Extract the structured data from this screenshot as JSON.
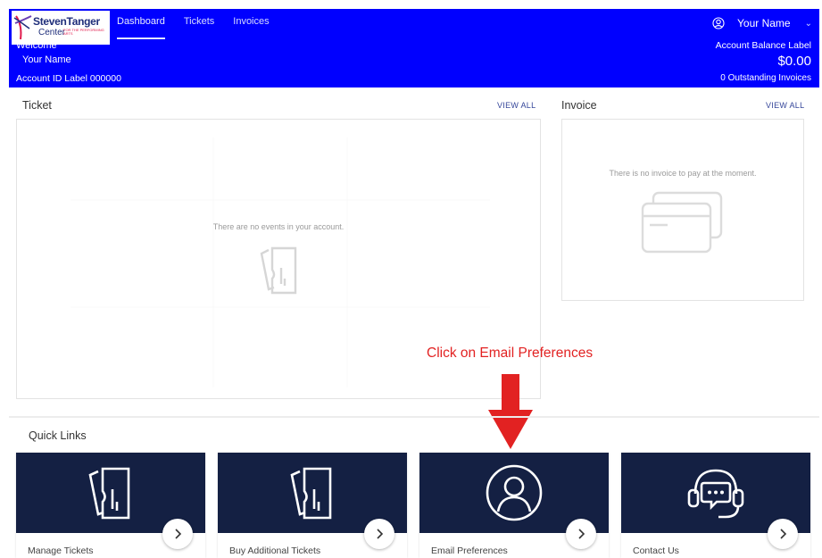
{
  "brand": {
    "logo_line1": "StevenTanger",
    "logo_line2": "Center",
    "logo_line3": "FOR THE PERFORMING ARTS"
  },
  "nav": {
    "items": [
      {
        "label": "Dashboard",
        "active": true
      },
      {
        "label": "Tickets",
        "active": false
      },
      {
        "label": "Invoices",
        "active": false
      }
    ]
  },
  "user": {
    "name": "Your Name",
    "user_icon": "user-circle-icon",
    "menu_icon": "chevron-down-icon"
  },
  "account": {
    "welcome": "Welcome",
    "name": "Your Name",
    "id_label": "Account ID Label 000000",
    "balance_label": "Account Balance Label",
    "balance": "$0.00",
    "outstanding": "0 Outstanding Invoices"
  },
  "ticket_panel": {
    "title": "Ticket",
    "view_all": "VIEW ALL",
    "empty_message": "There are no events in your account.",
    "empty_icon": "ticket-icon"
  },
  "invoice_panel": {
    "title": "Invoice",
    "view_all": "VIEW ALL",
    "empty_message": "There is no invoice to pay at the moment.",
    "empty_icon": "credit-card-icon"
  },
  "annotation": {
    "text": "Click on Email Preferences",
    "icon": "arrow-down-icon",
    "color": "#e22222"
  },
  "quick_links": {
    "title": "Quick Links",
    "items": [
      {
        "label": "Manage Tickets",
        "icon": "ticket-icon"
      },
      {
        "label": "Buy Additional Tickets",
        "icon": "ticket-icon"
      },
      {
        "label": "Email Preferences",
        "icon": "user-circle-icon"
      },
      {
        "label": "Contact Us",
        "icon": "headset-chat-icon"
      }
    ]
  },
  "colors": {
    "header_bg": "#0000ff",
    "card_band": "#142043",
    "link": "#35469a"
  }
}
